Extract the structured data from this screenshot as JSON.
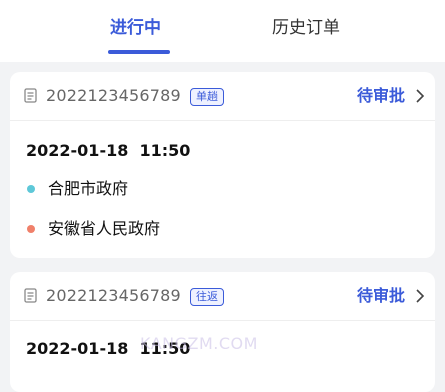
{
  "tabs": [
    {
      "label": "进行中",
      "active": true
    },
    {
      "label": "历史订单",
      "active": false
    }
  ],
  "orders": [
    {
      "order_no": "2022123456789",
      "trip_type": "单趟",
      "status": "待审批",
      "datetime": "2022-01-18  11:50",
      "start": "合肥市政府",
      "end": "安徽省人民政府"
    },
    {
      "order_no": "2022123456789",
      "trip_type": "往返",
      "status": "待审批",
      "datetime": "2022-01-18  11:50"
    }
  ],
  "watermark": "KANGZM.COM",
  "colors": {
    "accent": "#3b5bd9",
    "start_dot": "#5ec8d8",
    "end_dot": "#f0806a",
    "background": "#f2f3f5"
  },
  "icons": {
    "order": "document-icon",
    "status_arrow": "chevron-right-icon"
  }
}
